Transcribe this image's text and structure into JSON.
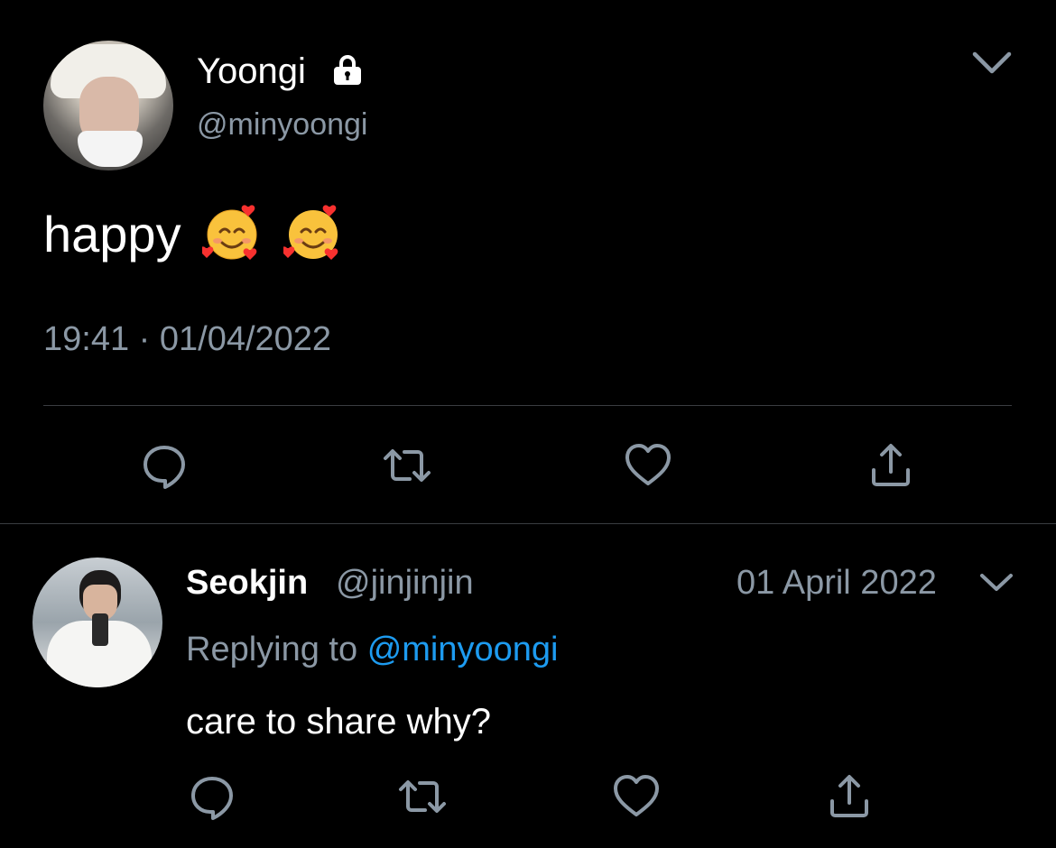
{
  "tweet": {
    "display_name": "Yoongi",
    "handle": "@minyoongi",
    "text": "happy",
    "emojis": [
      "smiling-face-with-hearts",
      "smiling-face-with-hearts"
    ],
    "timestamp": "19:41 · 01/04/2022",
    "icons": {
      "lock": "lock-icon",
      "menu": "chevron-down-icon",
      "reply": "reply-icon",
      "retweet": "retweet-icon",
      "like": "heart-icon",
      "share": "share-icon"
    }
  },
  "reply": {
    "display_name": "Seokjin",
    "handle": "@jinjinjin",
    "date": "01 April 2022",
    "replying_to_prefix": "Replying to",
    "replying_to_handle": "@minyoongi",
    "text": "care to share why?"
  },
  "colors": {
    "background": "#000000",
    "text_primary": "#ffffff",
    "text_secondary": "#8b98a5",
    "link": "#1d9bf0",
    "divider": "#3a3d41"
  }
}
